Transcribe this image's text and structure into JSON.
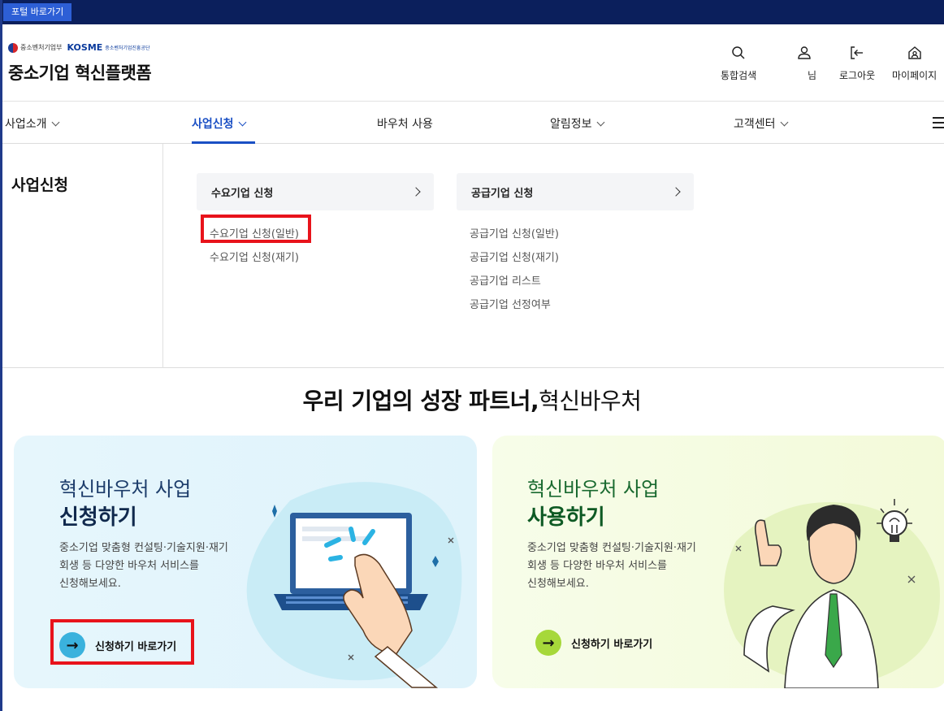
{
  "topbar": {
    "portal_link": "포털 바로가기"
  },
  "header": {
    "ministry": "중소벤처기업부",
    "kosme": "KOSME",
    "kosme_sub": "중소벤처기업진흥공단",
    "site_title": "중소기업 혁신플랫폼",
    "utils": [
      {
        "label": "통합검색",
        "icon": "search-icon"
      },
      {
        "label": "님",
        "icon": "user-icon"
      },
      {
        "label": "로그아웃",
        "icon": "logout-icon"
      },
      {
        "label": "마이페이지",
        "icon": "home-user-icon"
      }
    ]
  },
  "nav": {
    "items": [
      {
        "label": "사업소개",
        "dropdown": true
      },
      {
        "label": "사업신청",
        "dropdown": true,
        "active": true
      },
      {
        "label": "바우처 사용",
        "dropdown": false
      },
      {
        "label": "알림정보",
        "dropdown": true
      },
      {
        "label": "고객센터",
        "dropdown": true
      }
    ]
  },
  "submenu": {
    "title": "사업신청",
    "groups": [
      {
        "title": "수요기업 신청",
        "links": [
          "수요기업 신청(일반)",
          "수요기업 신청(재기)"
        ]
      },
      {
        "title": "공급기업 신청",
        "links": [
          "공급기업 신청(일반)",
          "공급기업 신청(재기)",
          "공급기업 리스트",
          "공급기업 선정여부"
        ]
      }
    ]
  },
  "banner": {
    "title_bold": "우리 기업의 성장 파트너,",
    "title_regular": "혁신바우처",
    "cards": [
      {
        "line1": "혁신바우처 사업",
        "line2": "신청하기",
        "desc": [
          "중소기업 맞춤형 컨설팅·기술지원·재기",
          "회생 등 다양한 바우처 서비스를",
          "신청해보세요."
        ],
        "button": "신청하기 바로가기",
        "button_icon": "→"
      },
      {
        "line1": "혁신바우처 사업",
        "line2": "사용하기",
        "desc": [
          "중소기업 맞춤형 컨설팅·기술지원·재기",
          "회생 등 다양한 바우처 서비스를",
          "신청해보세요."
        ],
        "button": "신청하기 바로가기",
        "button_icon": "→"
      }
    ]
  },
  "colors": {
    "accent": "#1a4fc4",
    "highlight": "#e8131b",
    "topbar": "#0b1f5c"
  }
}
